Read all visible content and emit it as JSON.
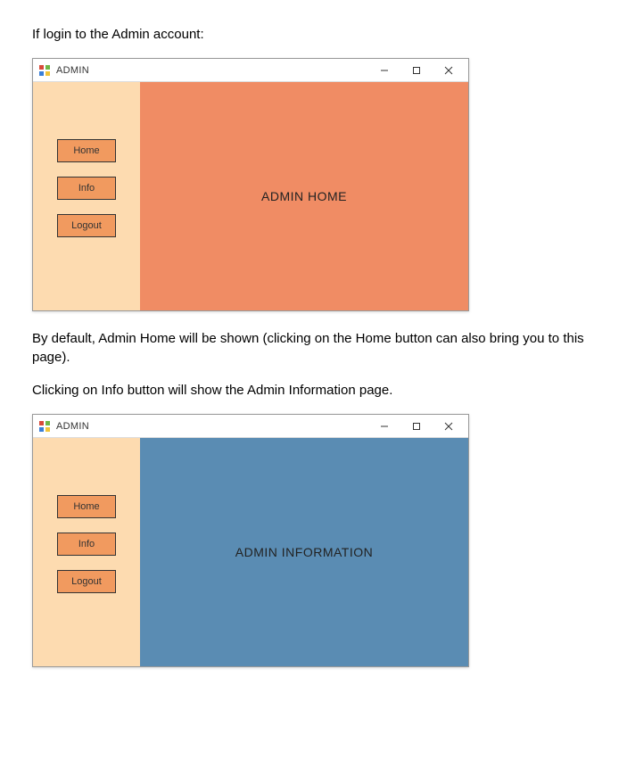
{
  "doc": {
    "intro": "If login to the Admin account:",
    "mid1": "By default, Admin Home will be shown (clicking on the Home button can also bring you to this page).",
    "mid2": "Clicking on Info button will show the Admin Information page."
  },
  "window1": {
    "title": "ADMIN",
    "sidebar": {
      "home": "Home",
      "info": "Info",
      "logout": "Logout"
    },
    "main_label": "ADMIN HOME"
  },
  "window2": {
    "title": "ADMIN",
    "sidebar": {
      "home": "Home",
      "info": "Info",
      "logout": "Logout"
    },
    "main_label": "ADMIN INFORMATION"
  }
}
